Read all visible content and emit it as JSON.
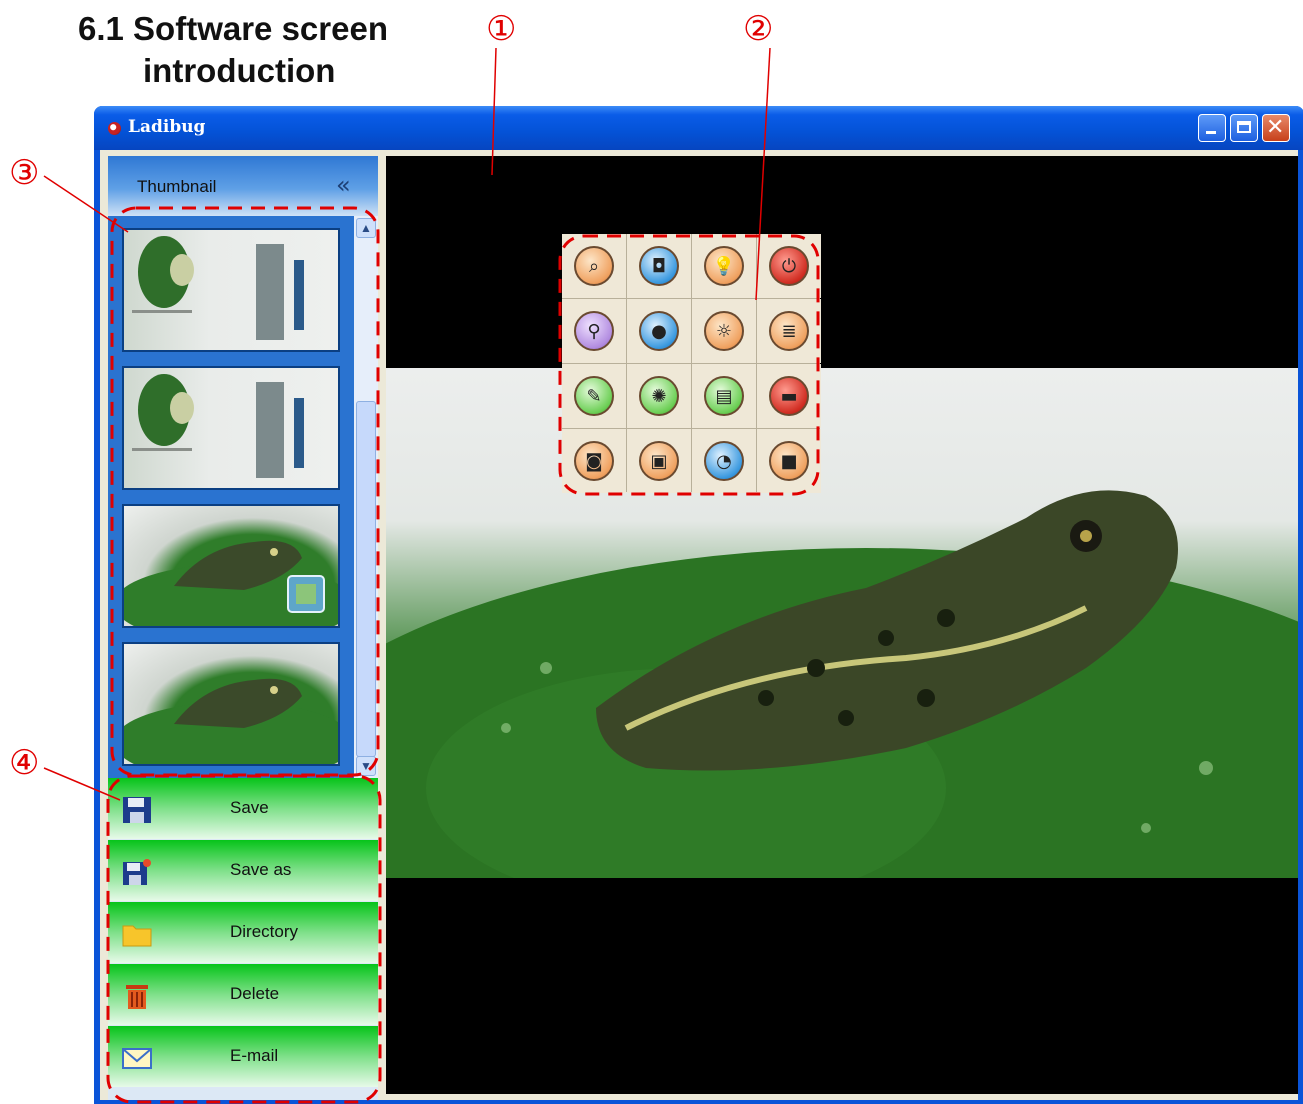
{
  "heading": {
    "line1": "6.1 Software screen",
    "line2": "introduction"
  },
  "callouts": [
    "①",
    "②",
    "③",
    "④"
  ],
  "window": {
    "title": "Ladibug",
    "controls": {
      "close_glyph": "✕"
    }
  },
  "sidebar": {
    "title": "Thumbnail",
    "collapse_glyph": "«",
    "scroll_up_glyph": "▲",
    "scroll_down_glyph": "▼",
    "thumbnails": [
      {
        "kind": "document"
      },
      {
        "kind": "document"
      },
      {
        "kind": "frog",
        "badge": "video"
      },
      {
        "kind": "frog"
      }
    ],
    "actions": [
      {
        "label": "Save",
        "icon": "floppy-disk-icon"
      },
      {
        "label": "Save as",
        "icon": "floppy-disk-star-icon"
      },
      {
        "label": "Directory",
        "icon": "folder-icon"
      },
      {
        "label": "Delete",
        "icon": "trash-can-icon"
      },
      {
        "label": "E-mail",
        "icon": "envelope-icon"
      }
    ]
  },
  "toolbar": {
    "tools": [
      {
        "icon": "document-magnifier-icon",
        "glyph": "⌕",
        "color": "orange"
      },
      {
        "icon": "camera-car-icon",
        "glyph": "◘",
        "color": "blue"
      },
      {
        "icon": "lamp-icon",
        "glyph": "💡",
        "color": "orange"
      },
      {
        "icon": "power-icon",
        "glyph": "⏻",
        "color": "red"
      },
      {
        "icon": "zoom-icon",
        "glyph": "⚲",
        "color": "purple"
      },
      {
        "icon": "ladybug-icon",
        "glyph": "●",
        "color": "blue"
      },
      {
        "icon": "brightness-icon",
        "glyph": "☼",
        "color": "orange"
      },
      {
        "icon": "settings-list-icon",
        "glyph": "≣",
        "color": "orange"
      },
      {
        "icon": "annotation-pen-icon",
        "glyph": "✎",
        "color": "green"
      },
      {
        "icon": "auto-focus-icon",
        "glyph": "✺",
        "color": "green"
      },
      {
        "icon": "notes-icon",
        "glyph": "▤",
        "color": "green"
      },
      {
        "icon": "window-icon",
        "glyph": "▬",
        "color": "red"
      },
      {
        "icon": "capture-camera-icon",
        "glyph": "◙",
        "color": "orange"
      },
      {
        "icon": "record-video-icon",
        "glyph": "▣",
        "color": "orange"
      },
      {
        "icon": "timer-icon",
        "glyph": "◔",
        "color": "blue"
      },
      {
        "icon": "full-screen-icon",
        "glyph": "■",
        "color": "orange"
      }
    ]
  }
}
